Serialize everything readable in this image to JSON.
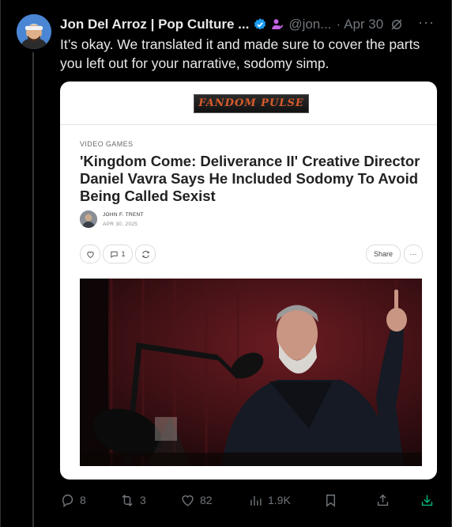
{
  "tweet": {
    "author_name": "Jon Del Arroz | Pop Culture ...",
    "handle": "@jon...",
    "separator": "·",
    "date": "Apr 30",
    "more": "···",
    "text": "It’s okay. We translated it and made sure to cover the parts you left out for your narrative, sodomy simp."
  },
  "card": {
    "logo_text": "FANDOM PULSE",
    "kicker": "VIDEO GAMES",
    "headline": "'Kingdom Come: Deliverance II' Creative Director Daniel Vavra Says He Included Sodomy To Avoid Being Called Sexist",
    "author": "JOHN F. TRENT",
    "pub_date": "APR 30, 2025",
    "comment_count": "1",
    "share_label": "Share",
    "more_label": "···"
  },
  "actions": {
    "replies": "8",
    "reposts": "3",
    "likes": "82",
    "views": "1.9K"
  },
  "colors": {
    "background": "#000000",
    "text": "#e7e9ea",
    "muted": "#71767b",
    "verified": "#1d9bf0",
    "download": "#00ba7c"
  }
}
